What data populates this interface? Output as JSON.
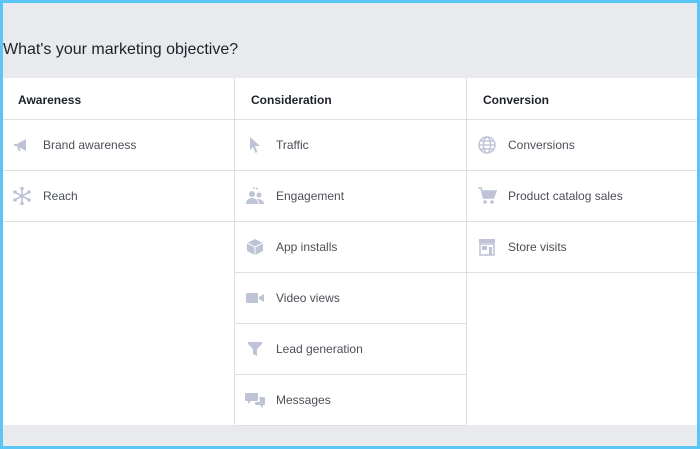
{
  "page": {
    "title": "What's your marketing objective?"
  },
  "columns": [
    {
      "header": "Awareness",
      "items": [
        {
          "label": "Brand awareness",
          "icon": "megaphone-icon"
        },
        {
          "label": "Reach",
          "icon": "reach-icon"
        }
      ]
    },
    {
      "header": "Consideration",
      "items": [
        {
          "label": "Traffic",
          "icon": "cursor-icon"
        },
        {
          "label": "Engagement",
          "icon": "people-icon"
        },
        {
          "label": "App installs",
          "icon": "box-icon"
        },
        {
          "label": "Video views",
          "icon": "video-camera-icon"
        },
        {
          "label": "Lead generation",
          "icon": "funnel-icon"
        },
        {
          "label": "Messages",
          "icon": "chat-bubbles-icon"
        }
      ]
    },
    {
      "header": "Conversion",
      "items": [
        {
          "label": "Conversions",
          "icon": "globe-icon"
        },
        {
          "label": "Product catalog sales",
          "icon": "shopping-cart-icon"
        },
        {
          "label": "Store visits",
          "icon": "storefront-icon"
        }
      ]
    }
  ],
  "colors": {
    "frame": "#5bc6f5",
    "icon": "#bec3d6",
    "header_band": "#e9eaed"
  }
}
